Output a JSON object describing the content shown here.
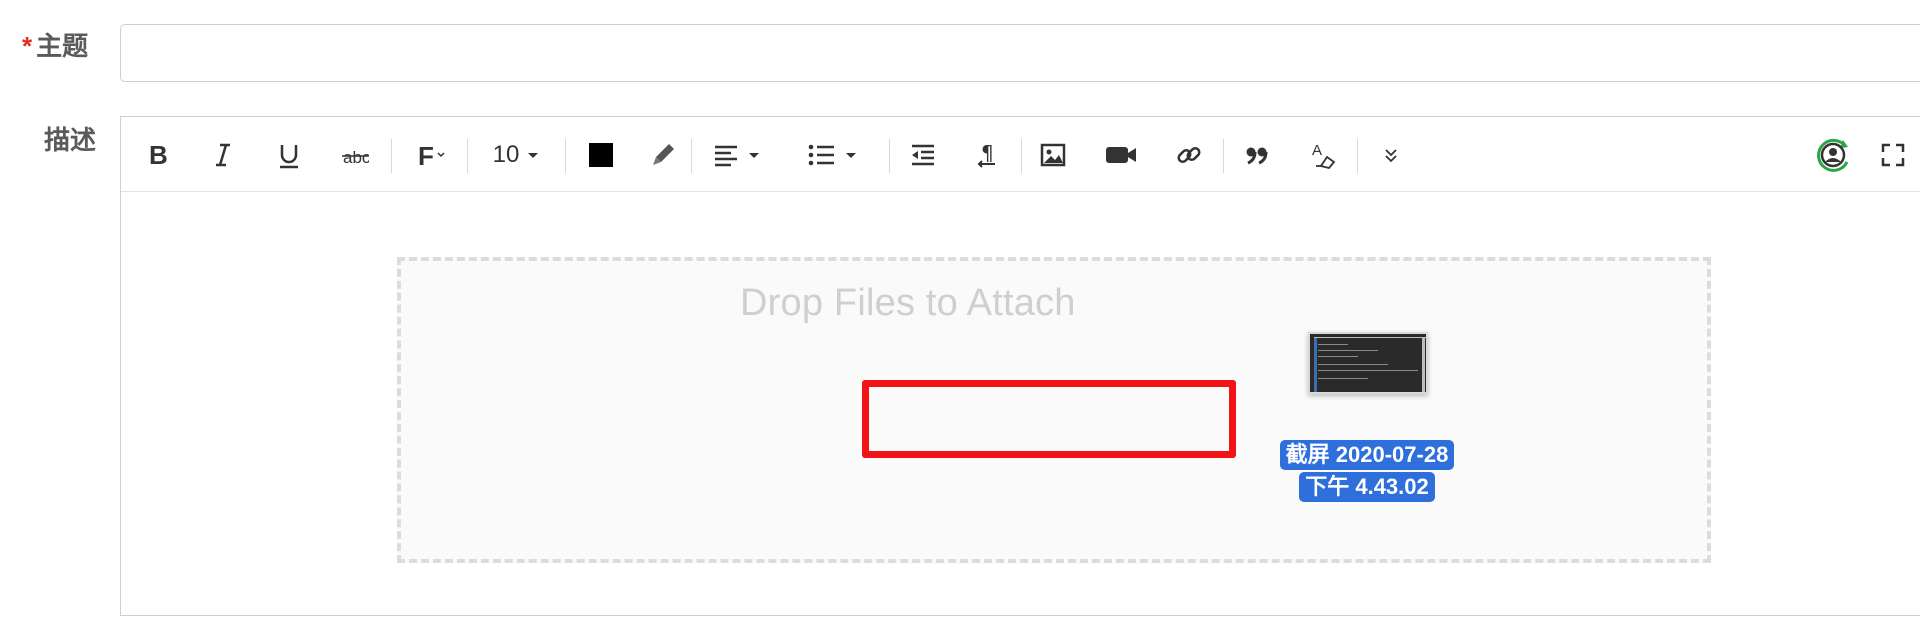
{
  "form": {
    "subject_label": "主题",
    "required_mark": "*",
    "subject_value": "",
    "description_label": "描述"
  },
  "toolbar": {
    "font_size": "10",
    "text_color": "#000000",
    "icons": [
      "bold-icon",
      "italic-icon",
      "underline-icon",
      "strikethrough-icon",
      "font-family-icon",
      "font-color-icon",
      "highlight-icon",
      "align-icon",
      "list-icon",
      "outdent-icon",
      "paragraph-icon",
      "image-icon",
      "video-icon",
      "link-icon",
      "quote-icon",
      "clear-format-icon",
      "more-icon",
      "user-sync-icon",
      "fullscreen-icon"
    ]
  },
  "dropzone": {
    "text": "Drop Files to Attach",
    "highlight_color": "#f01414"
  },
  "drag_file": {
    "name_line1": "截屏 2020-07-28",
    "name_line2": "下午 4.43.02"
  }
}
